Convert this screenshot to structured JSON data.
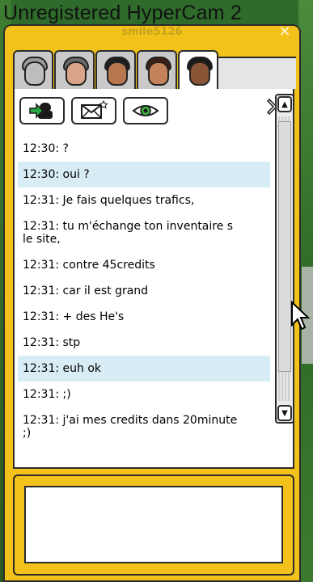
{
  "watermark": "Unregistered HyperCam 2",
  "window": {
    "title": "smile5126",
    "close_glyph": "✕"
  },
  "tabs": [
    {
      "name": "tab-friend-1",
      "active": false
    },
    {
      "name": "tab-friend-2",
      "active": false
    },
    {
      "name": "tab-friend-3",
      "active": false
    },
    {
      "name": "tab-friend-4",
      "active": false
    },
    {
      "name": "tab-friend-5",
      "active": true
    }
  ],
  "toolbar": {
    "follow_icon": "follow-user-icon",
    "mail_icon": "send-message-icon",
    "view_icon": "view-profile-icon",
    "remove_icon": "remove-icon"
  },
  "messages": [
    {
      "time": "12:30:",
      "text": "?",
      "highlight": false
    },
    {
      "time": "12:30:",
      "text": "oui ?",
      "highlight": true
    },
    {
      "time": "12:31:",
      "text": "Je fais quelques trafics,",
      "highlight": false
    },
    {
      "time": "12:31:",
      "text": "tu m'échange ton inventaire s\nle site,",
      "highlight": false
    },
    {
      "time": "12:31:",
      "text": "contre 45credits",
      "highlight": false
    },
    {
      "time": "12:31:",
      "text": "car il est grand",
      "highlight": false
    },
    {
      "time": "12:31:",
      "text": "+ des He's",
      "highlight": false
    },
    {
      "time": "12:31:",
      "text": "stp",
      "highlight": false
    },
    {
      "time": "12:31:",
      "text": "euh ok",
      "highlight": true
    },
    {
      "time": "12:31:",
      "text": ";)",
      "highlight": false
    },
    {
      "time": "12:31:",
      "text": "j'ai mes credits dans 20minute\n;)",
      "highlight": false
    }
  ],
  "scrollbar": {
    "up_glyph": "▲",
    "down_glyph": "▼"
  },
  "input": {
    "value": ""
  },
  "colors": {
    "window": "#f2c21a",
    "highlight": "#d8ecf5",
    "border": "#2b2b2b"
  }
}
